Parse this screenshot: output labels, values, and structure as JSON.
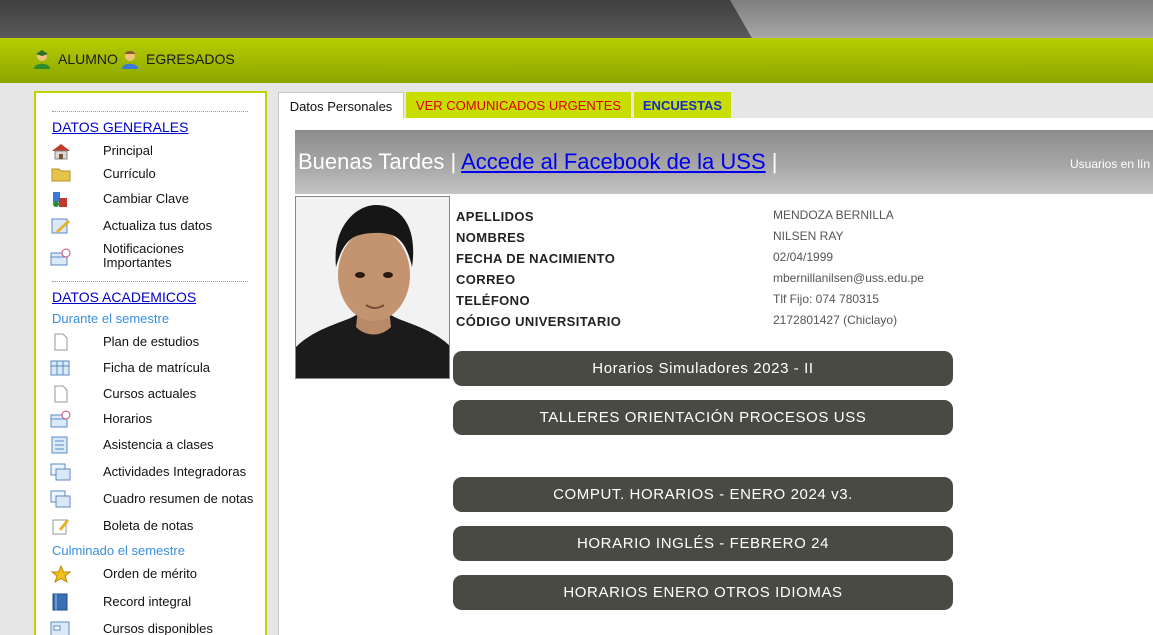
{
  "nav": {
    "alumno": "ALUMNO",
    "egresados": "EGRESADOS"
  },
  "sidebar": {
    "datos_generales": {
      "title": "DATOS GENERALES",
      "items": [
        {
          "label": "Principal",
          "icon": "house-icon"
        },
        {
          "label": "Currículo",
          "icon": "folder-icon"
        },
        {
          "label": "Cambiar Clave",
          "icon": "key-icon"
        },
        {
          "label": "Actualiza tus datos",
          "icon": "edit-icon"
        },
        {
          "label": "Notificaciones Importantes",
          "icon": "calendar-clock-icon"
        }
      ]
    },
    "datos_academicos": {
      "title": "DATOS ACADEMICOS",
      "durante": "Durante el semestre",
      "durante_items": [
        {
          "label": "Plan de estudios",
          "icon": "document-icon"
        },
        {
          "label": "Ficha de matrícula",
          "icon": "table-icon"
        },
        {
          "label": "Cursos actuales",
          "icon": "document-icon"
        },
        {
          "label": "Horarios",
          "icon": "calendar-clock-icon"
        },
        {
          "label": "Asistencia a clases",
          "icon": "list-icon"
        },
        {
          "label": "Actividades Integradoras",
          "icon": "windows-icon"
        },
        {
          "label": "Cuadro resumen de notas",
          "icon": "windows-icon"
        },
        {
          "label": "Boleta de notas",
          "icon": "notepad-icon"
        }
      ],
      "culminado": "Culminado el semestre",
      "culminado_items": [
        {
          "label": "Orden de mérito",
          "icon": "medal-icon"
        },
        {
          "label": "Record integral",
          "icon": "book-icon"
        },
        {
          "label": "Cursos disponibles",
          "icon": "form-icon"
        }
      ]
    }
  },
  "tabs": {
    "datos_personales": "Datos Personales",
    "urgentes": "VER COMUNICADOS URGENTES",
    "encuestas": "ENCUESTAS"
  },
  "greeting": {
    "text": "Buenas Tardes |",
    "link": "Accede al Facebook de la USS",
    "after": "|",
    "online": "Usuarios en lín"
  },
  "student": {
    "fields": [
      {
        "label": "APELLIDOS",
        "value": "MENDOZA BERNILLA"
      },
      {
        "label": "NOMBRES",
        "value": "NILSEN RAY"
      },
      {
        "label": "FECHA DE NACIMIENTO",
        "value": "02/04/1999"
      },
      {
        "label": "CORREO",
        "value": "mbernillanilsen@uss.edu.pe"
      },
      {
        "label": "TELÉFONO",
        "value": "Tlf Fijo: 074 780315"
      },
      {
        "label": "CÓDIGO UNIVERSITARIO",
        "value": "2172801427 (Chiclayo)"
      }
    ]
  },
  "buttons": [
    "Horarios Simuladores 2023 - II",
    "TALLERES ORIENTACIÓN PROCESOS USS",
    "COMPUT. HORARIOS - ENERO 2024 v3.",
    "HORARIO INGLÉS - FEBRERO 24",
    "HORARIOS ENERO OTROS IDIOMAS"
  ],
  "colors": {
    "accent_green": "#b7d000",
    "tab_urgent_text": "#e00000",
    "tab_encuestas_text": "#1530c0",
    "link_blue": "#0000cc",
    "subtitle_blue": "#3a8fdc",
    "pill_bg": "#4a4a44"
  }
}
